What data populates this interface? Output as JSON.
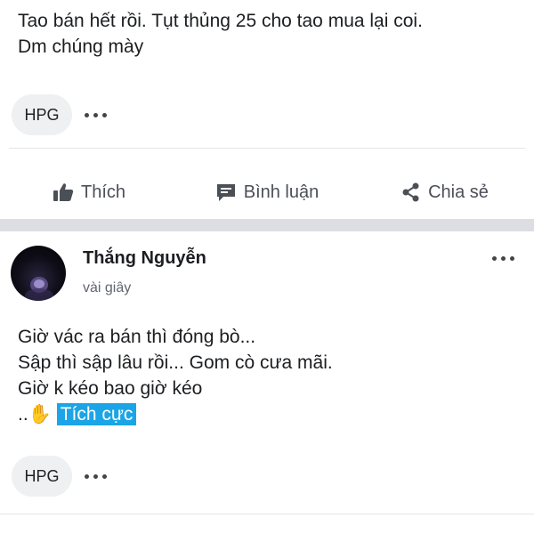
{
  "post1": {
    "text_lines": [
      "Tao bán hết rồi. Tụt thủng 25 cho tao mua lại coi.",
      "Dm chúng mày"
    ],
    "tag": "HPG"
  },
  "actions": {
    "like": "Thích",
    "comment": "Bình luận",
    "share": "Chia sẻ"
  },
  "post2": {
    "author": "Thắng Nguyễn",
    "time": "vài giây",
    "text_lines": [
      "Giờ vác ra bán thì đóng bò...",
      "Sập thì sập lâu rồi... Gom cò cưa mãi.",
      "Giờ k kéo bao giờ kéo"
    ],
    "last_line_prefix": "..",
    "hand_emoji": "✋",
    "sentiment": "Tích cực",
    "tag": "HPG"
  },
  "colors": {
    "sentiment_bg": "#1ba5e6",
    "chip_bg": "#eef0f2",
    "action_text": "#4b4f56"
  }
}
